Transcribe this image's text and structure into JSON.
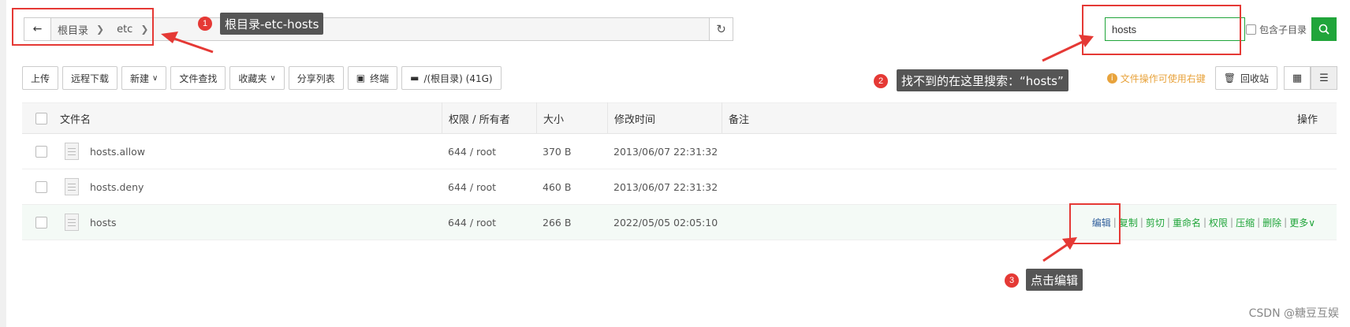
{
  "pathbar": {
    "crumbs": [
      "根目录",
      "etc"
    ]
  },
  "search": {
    "value": "hosts",
    "subdir_label": "包含子目录"
  },
  "toolbar": {
    "upload": "上传",
    "remote_download": "远程下载",
    "new": "新建",
    "file_search": "文件查找",
    "favorites": "收藏夹",
    "share_list": "分享列表",
    "terminal": "终端",
    "disk": "/(根目录) (41G)"
  },
  "right_tools": {
    "hint": "文件操作可使用右键",
    "recycle": "回收站"
  },
  "table": {
    "headers": {
      "name": "文件名",
      "perm": "权限 / 所有者",
      "size": "大小",
      "mtime": "修改时间",
      "note": "备注",
      "op": "操作"
    },
    "rows": [
      {
        "name": "hosts.allow",
        "perm": "644 / root",
        "size": "370 B",
        "mtime": "2013/06/07 22:31:32"
      },
      {
        "name": "hosts.deny",
        "perm": "644 / root",
        "size": "460 B",
        "mtime": "2013/06/07 22:31:32"
      },
      {
        "name": "hosts",
        "perm": "644 / root",
        "size": "266 B",
        "mtime": "2022/05/05 02:05:10"
      }
    ],
    "ops": [
      "编辑",
      "复制",
      "剪切",
      "重命名",
      "权限",
      "压缩",
      "删除",
      "更多"
    ]
  },
  "annotations": {
    "n1": "1",
    "t1": "根目录-etc-hosts",
    "n2": "2",
    "t2": "找不到的在这里搜索：“hosts”",
    "n3": "3",
    "t3": "点击编辑",
    "accent": "#e53935"
  },
  "watermark": "CSDN @糖豆互娱",
  "colors": {
    "primary": "#20a53a",
    "hint": "#e8a33c",
    "edit_link": "#2f5e9b"
  }
}
